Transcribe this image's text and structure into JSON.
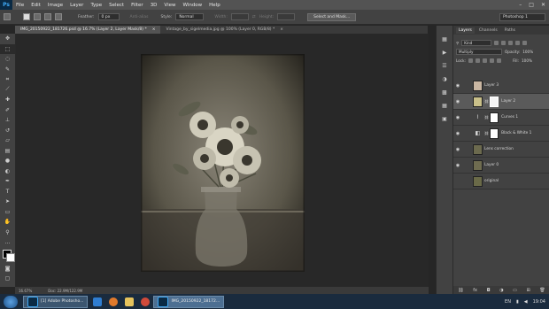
{
  "app": {
    "logo": "Ps",
    "menu": [
      "File",
      "Edit",
      "Image",
      "Layer",
      "Type",
      "Select",
      "Filter",
      "3D",
      "View",
      "Window",
      "Help"
    ],
    "window_controls": [
      "–",
      "□",
      "✕"
    ]
  },
  "options": {
    "feather_label": "Feather:",
    "feather_value": "0 px",
    "antialias_label": "Anti-alias",
    "style_label": "Style:",
    "style_value": "Normal",
    "width_label": "Width:",
    "height_label": "Height:",
    "select_mask_button": "Select and Mask...",
    "workspace": "Photoshop 1"
  },
  "tabs": [
    {
      "label": "IMG_20150922_181726.psd @ 16.7% (Layer 2, Layer Mask/8) *",
      "close": "×"
    },
    {
      "label": "Vintage_by_sigelmedia.jpg @ 100% (Layer 0, RGB/8) *",
      "close": "×"
    }
  ],
  "status": {
    "zoom": "16.67%",
    "doc": "Doc: 22.9M/122.9M"
  },
  "layers_panel": {
    "tabs": [
      "Layers",
      "Channels",
      "Paths"
    ],
    "kind_label": "Kind",
    "blend_mode": "Multiply",
    "opacity_label": "Opacity:",
    "opacity_value": "100%",
    "lock_label": "Lock:",
    "fill_label": "Fill:",
    "fill_value": "100%",
    "layers": [
      {
        "name": "Layer 3",
        "visible": true,
        "selected": false
      },
      {
        "name": "Layer 2",
        "visible": true,
        "selected": true
      },
      {
        "name": "Curves 1",
        "visible": true,
        "selected": false
      },
      {
        "name": "Black & White 1",
        "visible": true,
        "selected": false
      },
      {
        "name": "Lens correction",
        "visible": true,
        "selected": false
      },
      {
        "name": "Layer 0",
        "visible": true,
        "selected": false
      },
      {
        "name": "original",
        "visible": false,
        "selected": false
      }
    ],
    "footer_icons": [
      "link-icon",
      "fx-icon",
      "mask-icon",
      "adjustment-icon",
      "folder-icon",
      "new-layer-icon",
      "trash-icon"
    ]
  },
  "taskbar": {
    "items": [
      {
        "label": "[1] Adobe Photosho...",
        "active": false
      },
      {
        "label": "IMG_20150922_18172...",
        "active": true
      }
    ],
    "lang": "EN",
    "time": "19:04"
  },
  "colors": {
    "menubar": "#535353",
    "panel": "#424242",
    "canvas": "#282828",
    "taskbar": "#1a2b3e",
    "ps_blue": "#3fa9f5"
  }
}
